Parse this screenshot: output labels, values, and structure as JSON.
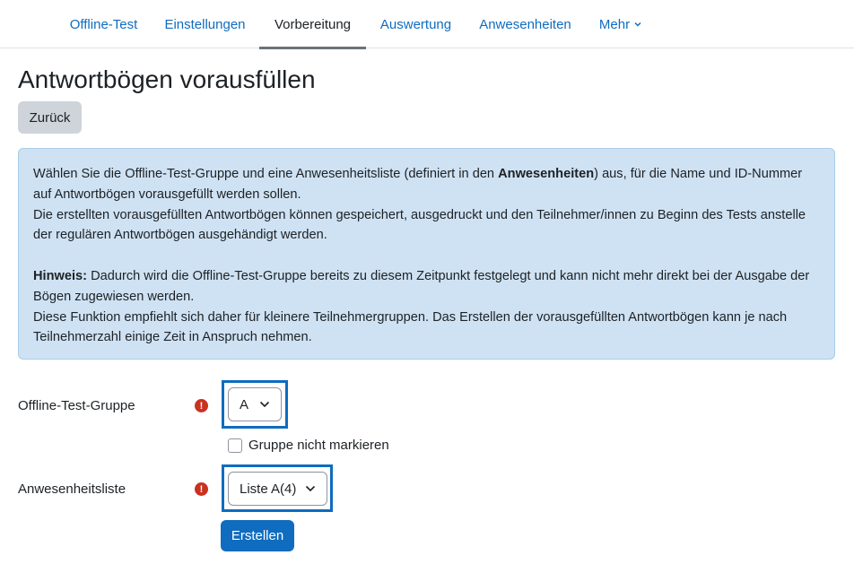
{
  "nav": {
    "tabs": [
      {
        "label": "Offline-Test"
      },
      {
        "label": "Einstellungen"
      },
      {
        "label": "Vorbereitung"
      },
      {
        "label": "Auswertung"
      },
      {
        "label": "Anwesenheiten"
      },
      {
        "label": "Mehr"
      }
    ],
    "active_tab": "Vorbereitung"
  },
  "page": {
    "title": "Antwortbögen vorausfüllen",
    "back_label": "Zurück"
  },
  "info": {
    "p1_before": "Wählen Sie die Offline-Test-Gruppe und eine Anwesenheitsliste (definiert in den ",
    "p1_bold": "Anwesenheiten",
    "p1_after": ") aus, für die Name und ID-Nummer auf Antwortbögen vorausgefüllt werden sollen.",
    "p2": "Die erstellten vorausgefüllten Antwortbögen können gespeichert, ausgedruckt und den Teilnehmer/innen zu Beginn des Tests anstelle der regulären Antwortbögen ausgehändigt werden.",
    "hint_label": "Hinweis:",
    "hint_text": " Dadurch wird die Offline-Test-Gruppe bereits zu diesem Zeitpunkt festgelegt und kann nicht mehr direkt bei der Ausgabe der Bögen zugewiesen werden.",
    "p4": "Diese Funktion empfiehlt sich daher für kleinere Teilnehmergruppen. Das Erstellen der vorausgefüllten Antwortbögen kann je nach Teilnehmerzahl einige Zeit in Anspruch nehmen."
  },
  "form": {
    "group_label": "Offline-Test-Gruppe",
    "group_value": "A",
    "required_mark": "!",
    "checkbox_label": "Gruppe nicht markieren",
    "checkbox_checked": false,
    "list_label": "Anwesenheitsliste",
    "list_value": "Liste A(4)",
    "submit_label": "Erstellen"
  },
  "colors": {
    "link": "#0f6cbf",
    "info_bg": "#cfe2f3",
    "required": "#ca3120",
    "primary": "#0f6cbf"
  }
}
